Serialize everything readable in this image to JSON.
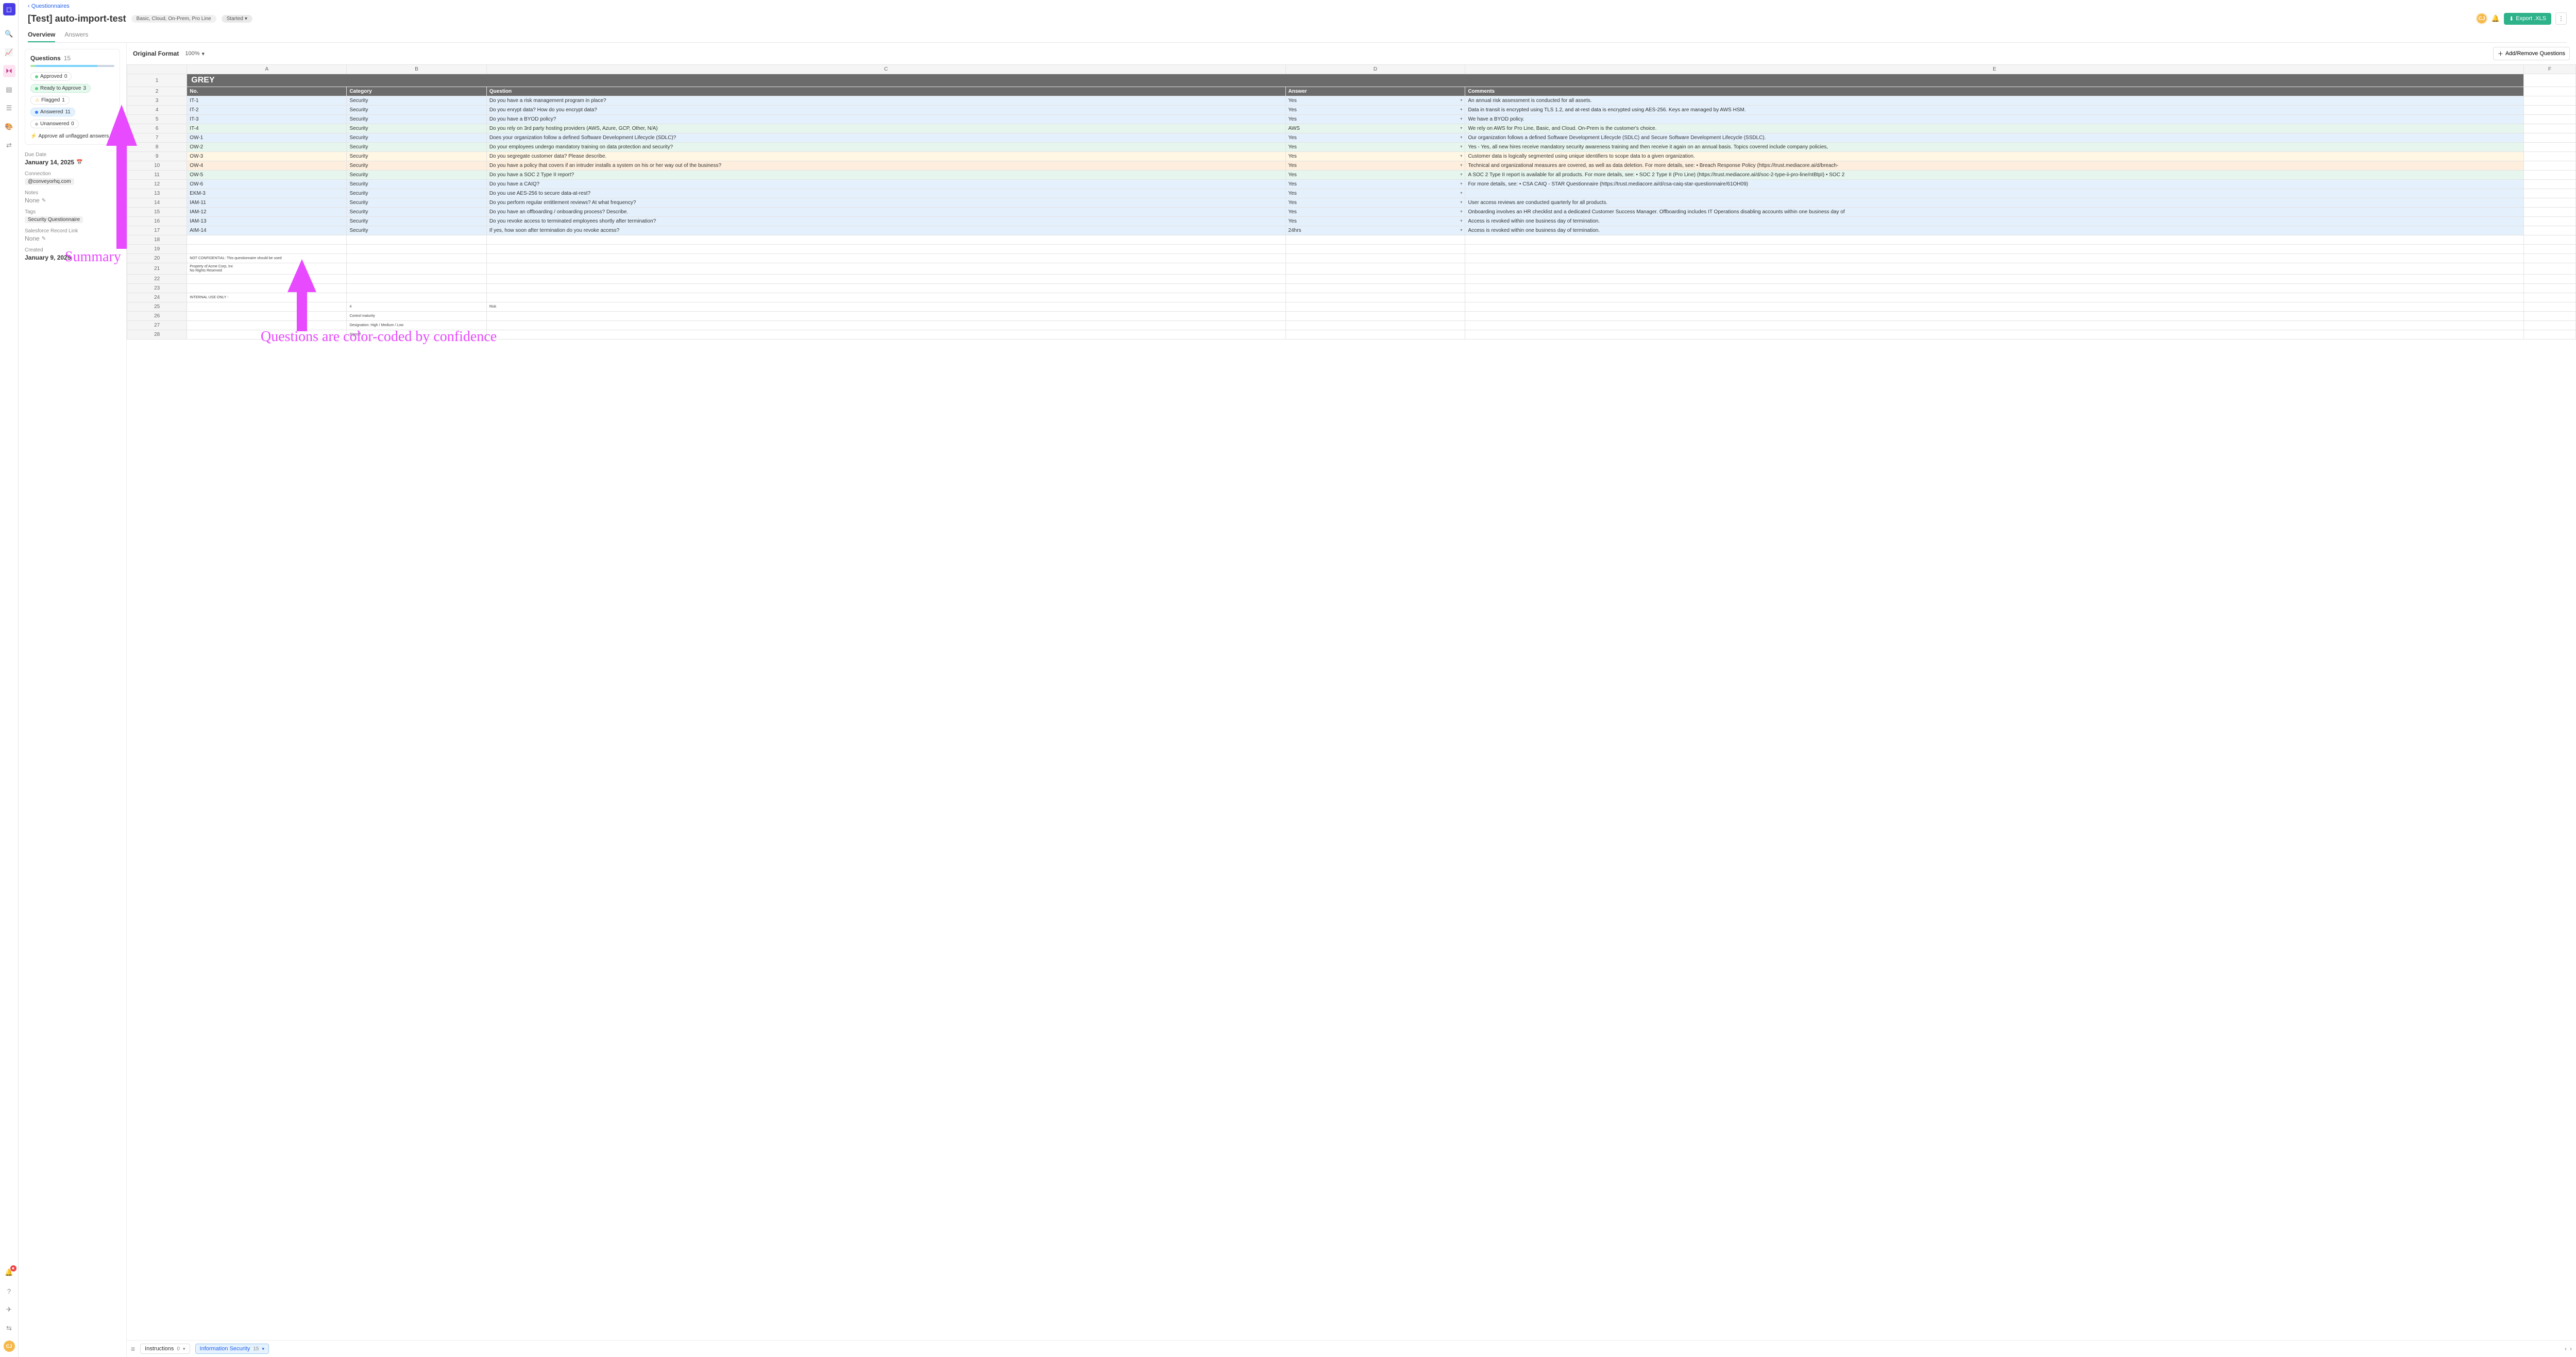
{
  "nav": {
    "breadcrumb": "‹ Questionnaires",
    "title": "[Test] auto-import-test",
    "lines_pill": "Basic, Cloud, On-Prem, Pro Line",
    "status": "Started",
    "avatar": "CJ",
    "export": "Export .XLS",
    "tab_overview": "Overview",
    "tab_answers": "Answers"
  },
  "sidebar": {
    "questions_label": "Questions",
    "questions_count": "15",
    "approved": {
      "label": "Approved",
      "count": "0"
    },
    "ready": {
      "label": "Ready to Approve",
      "count": "3"
    },
    "flagged": {
      "label": "Flagged",
      "count": "1"
    },
    "answered": {
      "label": "Answered",
      "count": "11"
    },
    "unanswered": {
      "label": "Unanswered",
      "count": "0"
    },
    "approve_all": "Approve all unflagged answers",
    "due_label": "Due Date",
    "due_value": "January 14, 2025",
    "conn_label": "Connection",
    "conn_value": "@conveyorhq.com",
    "notes_label": "Notes",
    "notes_value": "None",
    "tags_label": "Tags",
    "tags_value": "Security Questionnaire",
    "sf_label": "Salesforce Record Link",
    "sf_value": "None",
    "created_label": "Created",
    "created_value": "January 9, 2025"
  },
  "toolbar": {
    "format": "Original Format",
    "zoom": "100%",
    "addremove": "Add/Remove Questions"
  },
  "columns": [
    "A",
    "B",
    "C",
    "D",
    "E",
    "F"
  ],
  "grey_label": "GREY",
  "headers": {
    "no": "No.",
    "cat": "Category",
    "q": "Question",
    "a": "Answer",
    "c": "Comments"
  },
  "rows": [
    {
      "n": "IT-1",
      "cat": "Security",
      "q": "Do you have a risk management program in place?",
      "a": "Yes",
      "c": "An annual risk assessment is conducted for all assets.",
      "cls": "c-blue"
    },
    {
      "n": "IT-2",
      "cat": "Security",
      "q": "Do you enrypt data? How do you encrypt data?",
      "a": "Yes",
      "c": "Data in transit is encrypted using TLS 1.2, and at-rest data is encrypted using AES-256. Keys are managed by AWS HSM.",
      "cls": "c-blue"
    },
    {
      "n": "IT-3",
      "cat": "Security",
      "q": "Do you have a BYOD policy?",
      "a": "Yes",
      "c": "We have a BYOD policy.",
      "cls": "c-blue"
    },
    {
      "n": "IT-4",
      "cat": "Security",
      "q": "Do you rely on 3rd party hosting providers (AWS, Azure, GCP, Other, N/A)",
      "a": "AWS",
      "c": "We rely on AWS for Pro Line, Basic, and Cloud. On-Prem is the customer's choice.",
      "cls": "c-green"
    },
    {
      "n": "OW-1",
      "cat": "Security",
      "q": "Does your organization follow a defined Software Development Lifecycle (SDLC)?",
      "a": "Yes",
      "c": "Our organization follows a defined Software Development Lifecycle (SDLC) and Secure Software Development Lifecycle (SSDLC).",
      "cls": "c-blue"
    },
    {
      "n": "OW-2",
      "cat": "Security",
      "q": "Do your employees undergo mandatory training on data protection and security?",
      "a": "Yes",
      "c": "Yes - Yes, all new hires receive mandatory security awareness training and then receive it again on an annual basis. Topics covered include company policies,",
      "cls": "c-green"
    },
    {
      "n": "OW-3",
      "cat": "Security",
      "q": "Do you segregate customer data? Please describe.",
      "a": "Yes",
      "c": "Customer data is logically segmented using unique identifiers to scope data to a given organization.",
      "cls": "c-yellow"
    },
    {
      "n": "OW-4",
      "cat": "Security",
      "q": "Do you have a policy that covers if an intruder installs a system on his or her way out of the business?",
      "a": "Yes",
      "c": "Technical and organizational measures are covered, as well as data deletion. For more details, see: • Breach Response Policy (https://trust.mediacore.ai/d/breach-",
      "cls": "c-orange"
    },
    {
      "n": "OW-5",
      "cat": "Security",
      "q": "Do you have a SOC 2 Type II report?",
      "a": "Yes",
      "c": "A SOC 2 Type II report is available for all products. For more details, see: • SOC 2 Type II (Pro Line) (https://trust.mediacore.ai/d/soc-2-type-ii-pro-line/ntBtpI) • SOC 2",
      "cls": "c-green"
    },
    {
      "n": "OW-6",
      "cat": "Security",
      "q": "Do you have a CAIQ?",
      "a": "Yes",
      "c": "For more details, see: • CSA CAIQ - STAR Questionnaire (https://trust.mediacore.ai/d/csa-caiq-star-questionnaire/61OH09)",
      "cls": "c-blue"
    },
    {
      "n": "EKM-3",
      "cat": "Security",
      "q": "Do you use AES-256 to secure data-at-rest?",
      "a": "Yes",
      "c": "",
      "cls": "c-blue"
    },
    {
      "n": "IAM-11",
      "cat": "Security",
      "q": "Do you perform regular entitlement reviews? At what frequency?",
      "a": "Yes",
      "c": "User access reviews are conducted quarterly for all products.",
      "cls": "c-blue"
    },
    {
      "n": "IAM-12",
      "cat": "Security",
      "q": "Do you have an offboarding / onboarding process? Describe.",
      "a": "Yes",
      "c": "Onboarding involves an HR checklist and a dedicated Customer Success Manager. Offboarding includes IT Operations disabling accounts within one business day of",
      "cls": "c-blue"
    },
    {
      "n": "IAM-13",
      "cat": "Security",
      "q": "Do you revoke access to terminated employees shortly after termination?",
      "a": "Yes",
      "c": "Access is revoked within one business day of termination.",
      "cls": "c-blue"
    },
    {
      "n": "AIM-14",
      "cat": "Security",
      "q": "If yes, how soon after termination do you revoke access?",
      "a": "24hrs",
      "c": "Access is revoked within one business day of termination.",
      "cls": "c-blue"
    }
  ],
  "tail": {
    "r20": "NOT CONFIDENTIAL: This questionnaire should be used",
    "r21": "Property of Acme Corp, Inc\nNo Rights Reserved",
    "r24": "INTERNAL USE ONLY -",
    "r25b": "4",
    "r25c": "Risk",
    "r26": "Control maturity",
    "r27": "Designation: High / Medium / Low",
    "r28": "Signoff"
  },
  "footer": {
    "tab1": "Instructions",
    "tab1c": "0",
    "tab2": "Information Security",
    "tab2c": "15"
  },
  "annot": {
    "summary": "Summary",
    "confidence": "Questions are color-coded by confidence"
  }
}
